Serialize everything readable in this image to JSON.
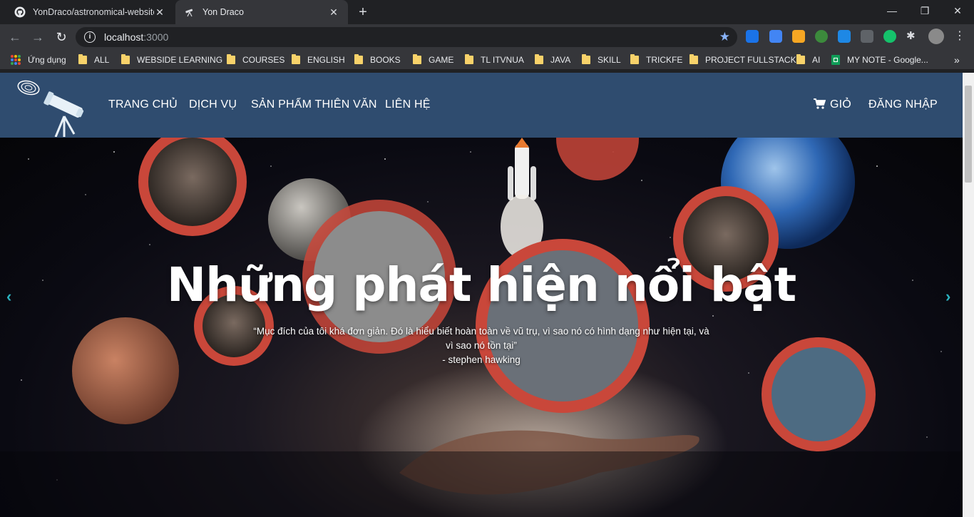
{
  "browser": {
    "tabs": [
      {
        "title": "YonDraco/astronomical-website",
        "active": false
      },
      {
        "title": "Yon Draco",
        "active": true
      }
    ],
    "address": {
      "host": "localhost",
      "port": ":3000"
    },
    "bookmarks": [
      "Ứng dụng",
      "ALL",
      "WEBSIDE LEARNING",
      "COURSES",
      "ENGLISH",
      "BOOKS",
      "GAME",
      "TL ITVNUA",
      "JAVA",
      "SKILL",
      "TRICKFE",
      "PROJECT FULLSTACK",
      "AI",
      "MY NOTE - Google..."
    ],
    "overflow": "»"
  },
  "site": {
    "nav": {
      "items": [
        "TRANG CHỦ",
        "DỊCH VỤ",
        "SẢN PHẨM THIÊN VĂN",
        "LIÊN HỆ"
      ],
      "cart": "GIỎ",
      "login": "ĐĂNG NHẬP",
      "bg_color": "#2f4c6f"
    },
    "hero": {
      "title": "Những phát hiện nổi bật",
      "quote": "“Mục đích của tôi khá đơn giản. Đó là hiểu biết hoàn toàn về vũ trụ, vì sao nó có hình dạng như hiện tại, và vì sao nó tồn tại”",
      "author": "- stephen hawking",
      "arrow_color": "#2bb3c0",
      "ring_color": "#c9473a"
    }
  }
}
